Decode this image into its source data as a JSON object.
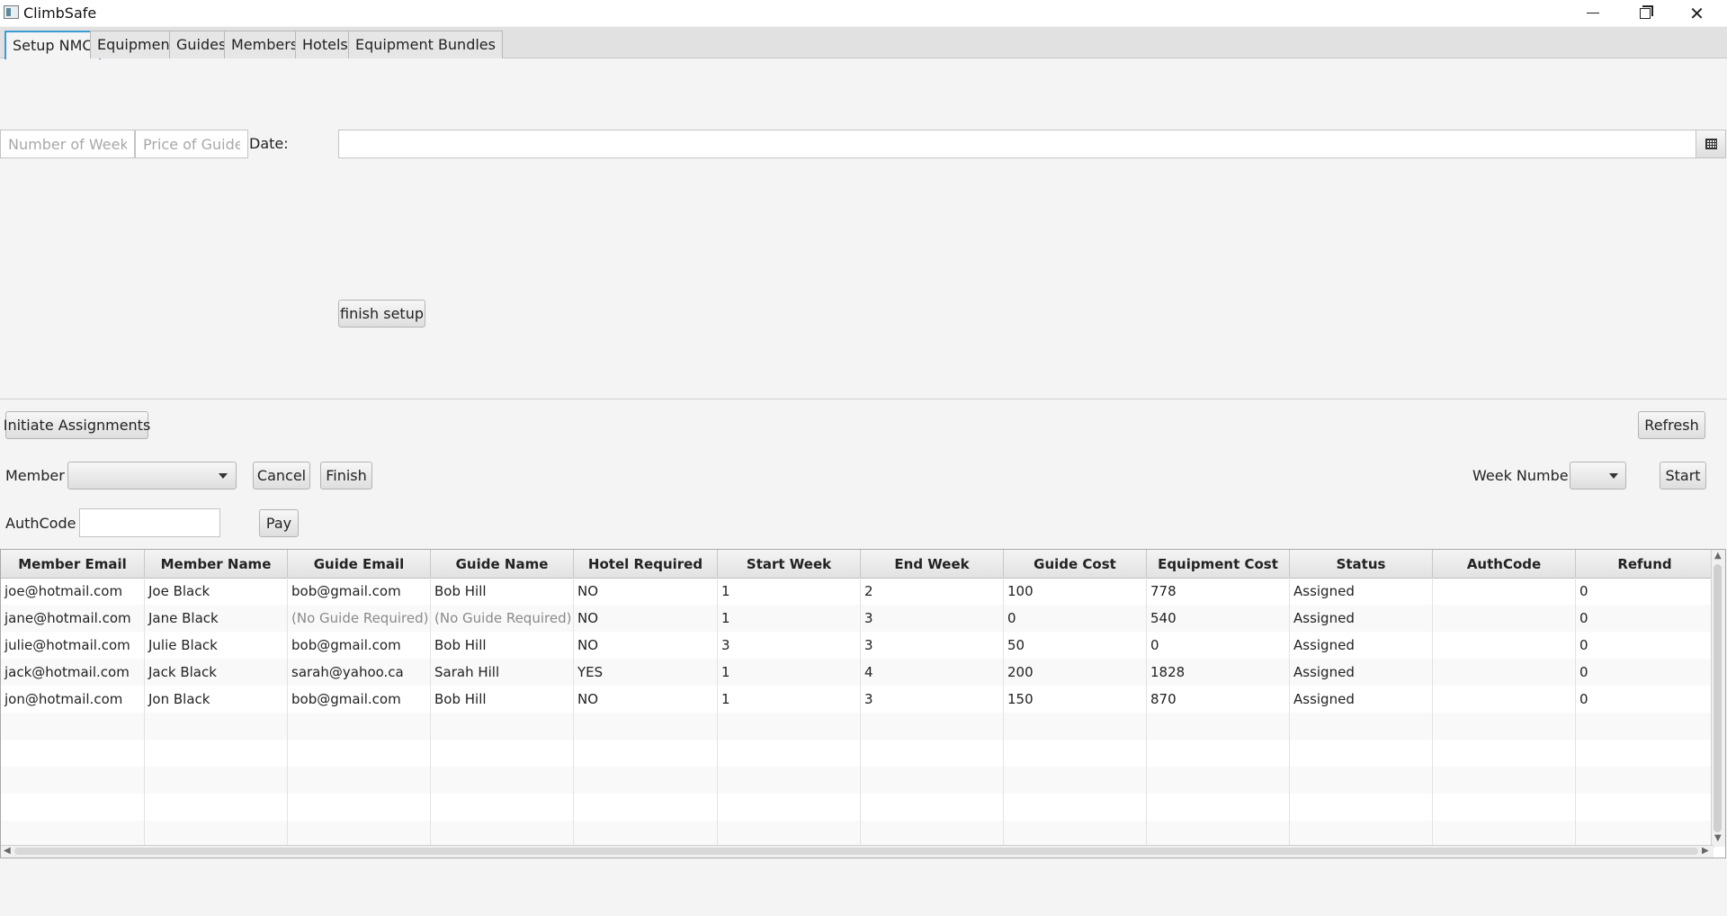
{
  "window": {
    "title": "ClimbSafe"
  },
  "tabs": [
    {
      "label": "Setup NMC"
    },
    {
      "label": "Equipment"
    },
    {
      "label": "Guides"
    },
    {
      "label": "Members"
    },
    {
      "label": "Hotels"
    },
    {
      "label": "Equipment Bundles"
    }
  ],
  "setup": {
    "weeks_placeholder": "Number of Weeks",
    "price_placeholder": "Price of Guide",
    "date_label": "Date:",
    "date_value": "",
    "finish_label": "finish setup"
  },
  "assign": {
    "initiate_label": "Initiate Assignments",
    "refresh_label": "Refresh",
    "member_label": "Member",
    "member_value": "",
    "cancel_label": "Cancel",
    "finish_label": "Finish",
    "week_label": "Week Number",
    "week_value": "",
    "start_label": "Start",
    "authcode_label": "AuthCode",
    "authcode_value": "",
    "pay_label": "Pay"
  },
  "table": {
    "columns": [
      "Member Email",
      "Member Name",
      "Guide Email",
      "Guide Name",
      "Hotel Required",
      "Start Week",
      "End Week",
      "Guide Cost",
      "Equipment Cost",
      "Status",
      "AuthCode",
      "Refund"
    ],
    "rows": [
      [
        "joe@hotmail.com",
        "Joe Black",
        "bob@gmail.com",
        "Bob Hill",
        "NO",
        "1",
        "2",
        "100",
        "778",
        "Assigned",
        "",
        "0"
      ],
      [
        "jane@hotmail.com",
        "Jane Black",
        "(No Guide Required)",
        "(No Guide Required)",
        "NO",
        "1",
        "3",
        "0",
        "540",
        "Assigned",
        "",
        "0"
      ],
      [
        "julie@hotmail.com",
        "Julie Black",
        "bob@gmail.com",
        "Bob Hill",
        "NO",
        "3",
        "3",
        "50",
        "0",
        "Assigned",
        "",
        "0"
      ],
      [
        "jack@hotmail.com",
        "Jack Black",
        "sarah@yahoo.ca",
        "Sarah Hill",
        "YES",
        "1",
        "4",
        "200",
        "1828",
        "Assigned",
        "",
        "0"
      ],
      [
        "jon@hotmail.com",
        "Jon Black",
        "bob@gmail.com",
        "Bob Hill",
        "NO",
        "1",
        "3",
        "150",
        "870",
        "Assigned",
        "",
        "0"
      ]
    ],
    "empty_rows": 5
  }
}
